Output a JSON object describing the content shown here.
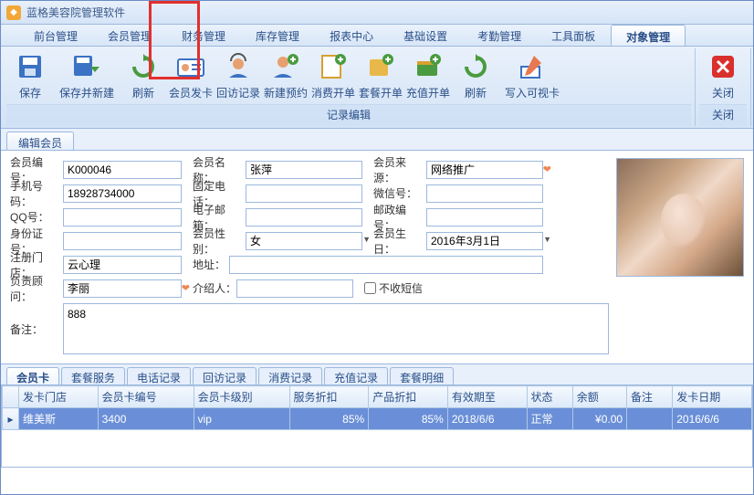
{
  "app_title": "蓝格美容院管理软件",
  "menu": [
    "前台管理",
    "会员管理",
    "财务管理",
    "库存管理",
    "报表中心",
    "基础设置",
    "考勤管理",
    "工具面板",
    "对象管理"
  ],
  "menu_active_index": 8,
  "ribbon": {
    "group1_caption": "记录编辑",
    "group2_caption": "关闭",
    "buttons": [
      "保存",
      "保存并新建",
      "刷新",
      "会员发卡",
      "回访记录",
      "新建预约",
      "消费开单",
      "套餐开单",
      "充值开单",
      "刷新",
      "写入可视卡"
    ],
    "close_btn": "关闭"
  },
  "subtab": "编辑会员",
  "form": {
    "labels": {
      "member_no": "会员编号：",
      "member_name": "会员名称：",
      "source": "会员来源：",
      "mobile": "手机号码：",
      "phone": "固定电话：",
      "wechat": "微信号：",
      "qq": "QQ号：",
      "email": "电子邮箱：",
      "post": "邮政编号：",
      "idcard": "身份证号：",
      "gender": "会员性别：",
      "birthday": "会员生日：",
      "reg_store": "注册门店：",
      "address": "地址：",
      "consultant": "负责顾问：",
      "referrer": "介绍人：",
      "no_sms": "不收短信",
      "remark": "备注："
    },
    "values": {
      "member_no": "K000046",
      "member_name": "张萍",
      "source": "网络推广",
      "mobile": "18928734000",
      "phone": "",
      "wechat": "",
      "qq": "",
      "email": "",
      "post": "",
      "idcard": "",
      "gender": "女",
      "birthday": "2016年3月1日",
      "reg_store": "云心理",
      "address": "",
      "consultant": "李丽",
      "referrer": "",
      "no_sms": false,
      "remark": "888"
    }
  },
  "bottom_tabs": [
    "会员卡",
    "套餐服务",
    "电话记录",
    "回访记录",
    "消费记录",
    "充值记录",
    "套餐明细"
  ],
  "bottom_active": 0,
  "grid": {
    "headers": [
      "发卡门店",
      "会员卡编号",
      "会员卡级别",
      "服务折扣",
      "产品折扣",
      "有效期至",
      "状态",
      "余额",
      "备注",
      "发卡日期"
    ],
    "row": {
      "store": "维美斯",
      "card_no": "3400",
      "level": "vip",
      "svc_disc": "85%",
      "prod_disc": "85%",
      "expire": "2018/6/6",
      "status": "正常",
      "balance": "¥0.00",
      "remark": "",
      "issue_date": "2016/6/6"
    }
  }
}
